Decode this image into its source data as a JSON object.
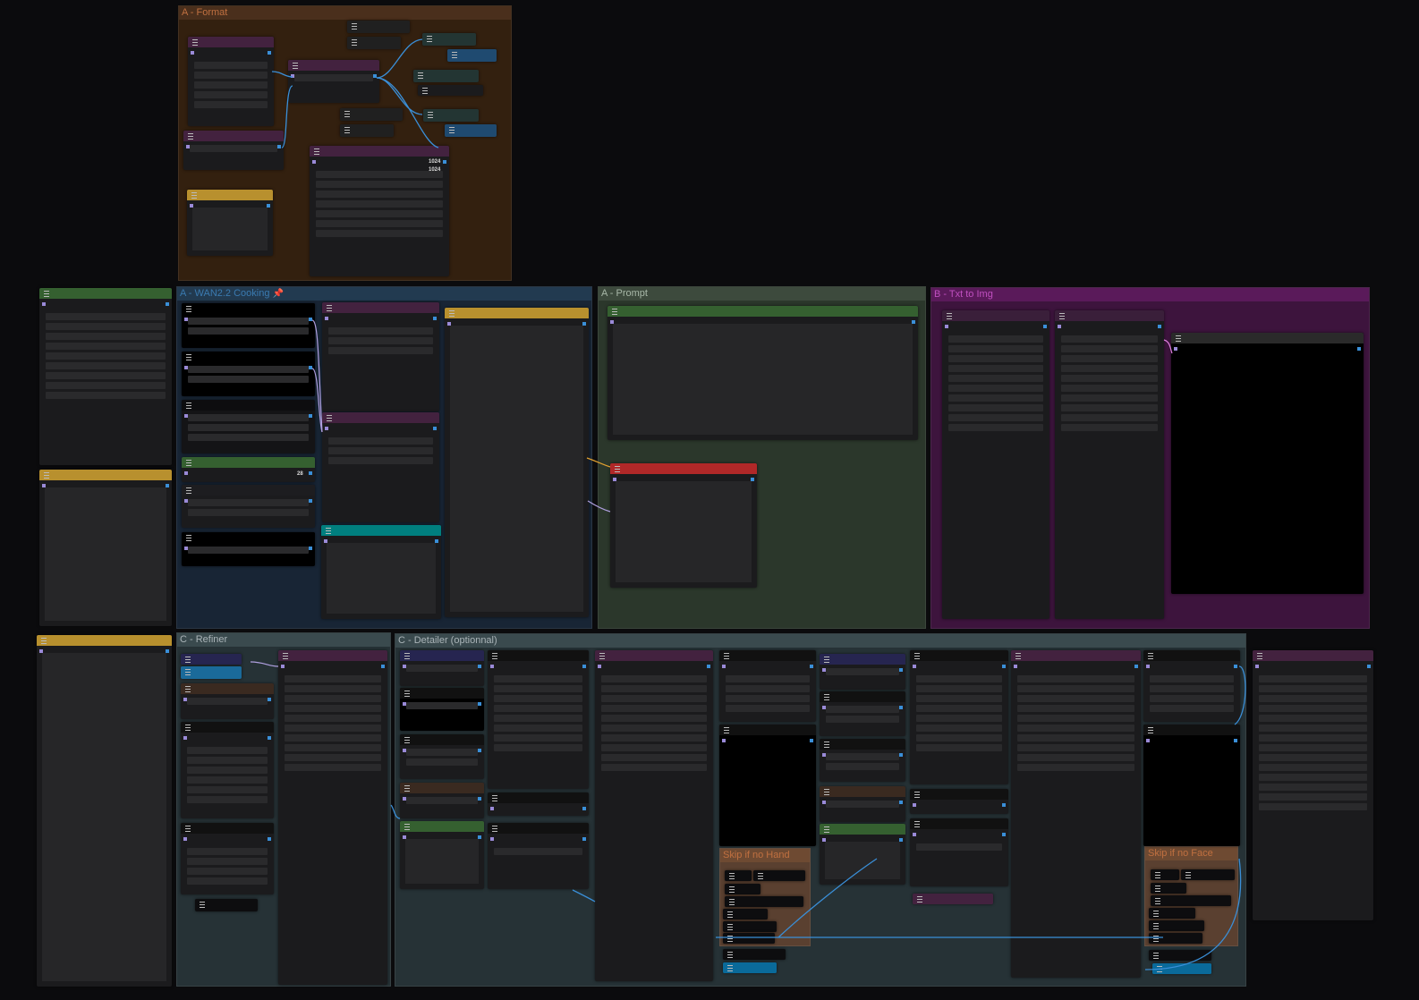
{
  "groups": {
    "format": "A - Format",
    "wan": "A - WAN2.2 Cooking",
    "prompt": "A - Prompt",
    "txt2img": "B - Txt to Img",
    "refiner": "C - Refiner",
    "detailer": "C - Detailer (optionnal)",
    "skip_hand": "Skip if no Hand",
    "skip_face": "Skip if no Face"
  },
  "values": {
    "width": "1024",
    "height": "1024",
    "steps": "28"
  },
  "icons": {
    "pin": "📌",
    "node_menu": "hamburger-icon"
  },
  "colors": {
    "canvas": "#0b0b0d",
    "format_group": "#33200f",
    "wan_group": "#182535",
    "prompt_group": "#2b372b",
    "txt2img_group": "#3d143d",
    "refiner_group": "#263236",
    "link_blue": "#3a8fd8"
  }
}
